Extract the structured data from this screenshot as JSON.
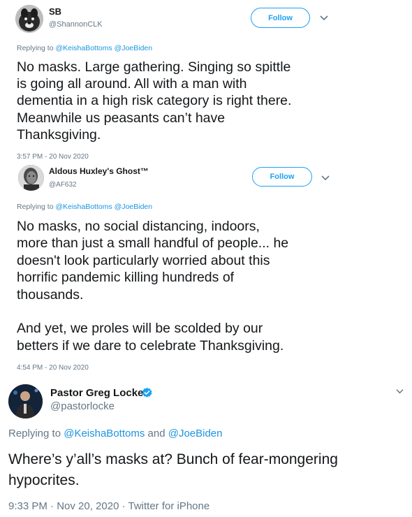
{
  "tweets": [
    {
      "name": "SB",
      "handle": "@ShannonCLK",
      "follow_label": "Follow",
      "reply_prefix": "Replying to ",
      "reply_to_1": "@KeishaBottoms",
      "reply_sep": " ",
      "reply_to_2": "@JoeBiden",
      "text": "No masks. Large gathering. Singing so spittle\nis going all around. All with a man with\ndementia in a high risk category is right there.\nMeanwhile us peasants can’t have\nThanksgiving.",
      "timestamp": "3:57 PM - 20 Nov 2020",
      "avatar_icon": "dog-avatar"
    },
    {
      "name": "Aldous Huxley's Ghost™",
      "handle": "@AF632",
      "follow_label": "Follow",
      "reply_prefix": "Replying to ",
      "reply_to_1": "@KeishaBottoms",
      "reply_sep": " ",
      "reply_to_2": "@JoeBiden",
      "text": "No masks, no social distancing, indoors,\nmore than just a small handful of people... he\ndoesn't look particularly worried about this\nhorrific pandemic killing hundreds of\nthousands.\n\nAnd yet, we proles will be scolded by our\nbetters if we dare to celebrate Thanksgiving.",
      "timestamp": "4:54 PM - 20 Nov 2020",
      "avatar_icon": "portrait-avatar"
    },
    {
      "name": "Pastor Greg Locke",
      "handle": "@pastorlocke",
      "verified_icon": "verified-badge-icon",
      "reply_prefix": "Replying to ",
      "reply_to_1": "@KeishaBottoms",
      "reply_sep": " and ",
      "reply_to_2": "@JoeBiden",
      "text": "Where’s y’all’s masks at? Bunch of fear-mongering\nhypocrites.",
      "timestamp": "9:33 PM · Nov 20, 2020 · Twitter for iPhone",
      "avatar_icon": "speaker-avatar"
    }
  ],
  "colors": {
    "accent": "#1da1f2",
    "link": "#1b95e0",
    "muted": "#657786",
    "text": "#14171a"
  }
}
